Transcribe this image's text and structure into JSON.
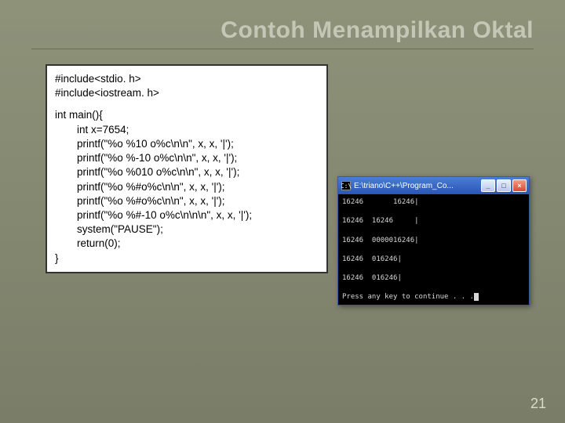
{
  "title": "Contoh Menampilkan Oktal",
  "page_number": "21",
  "code_lines": [
    "#include<stdio. h>",
    "#include<iostream. h>",
    "",
    "int main(){",
    "    int x=7654;",
    "    printf(\"%o   %10 o%c\\n\\n\", x, x, '|');",
    "    printf(\"%o   %-10 o%c\\n\\n\", x, x, '|');",
    "    printf(\"%o   %010 o%c\\n\\n\", x, x, '|');",
    "    printf(\"%o   %#o%c\\n\\n\", x, x, '|');",
    "    printf(\"%o   %#o%c\\n\\n\", x, x, '|');",
    "    printf(\"%o   %#-10 o%c\\n\\n\\n\", x, x, '|');",
    "    system(\"PAUSE\");",
    "    return(0);",
    "}"
  ],
  "console": {
    "title_icon_glyph": "C:\\",
    "title": "E:\\triano\\C++\\Program_Co...",
    "buttons": {
      "min": "_",
      "max": "□",
      "close": "×"
    },
    "output_lines": [
      "16246       16246|",
      "",
      "16246  16246     |",
      "",
      "16246  0000016246|",
      "",
      "16246  016246|",
      "",
      "16246  016246|",
      "",
      "Press any key to continue . . ."
    ]
  }
}
